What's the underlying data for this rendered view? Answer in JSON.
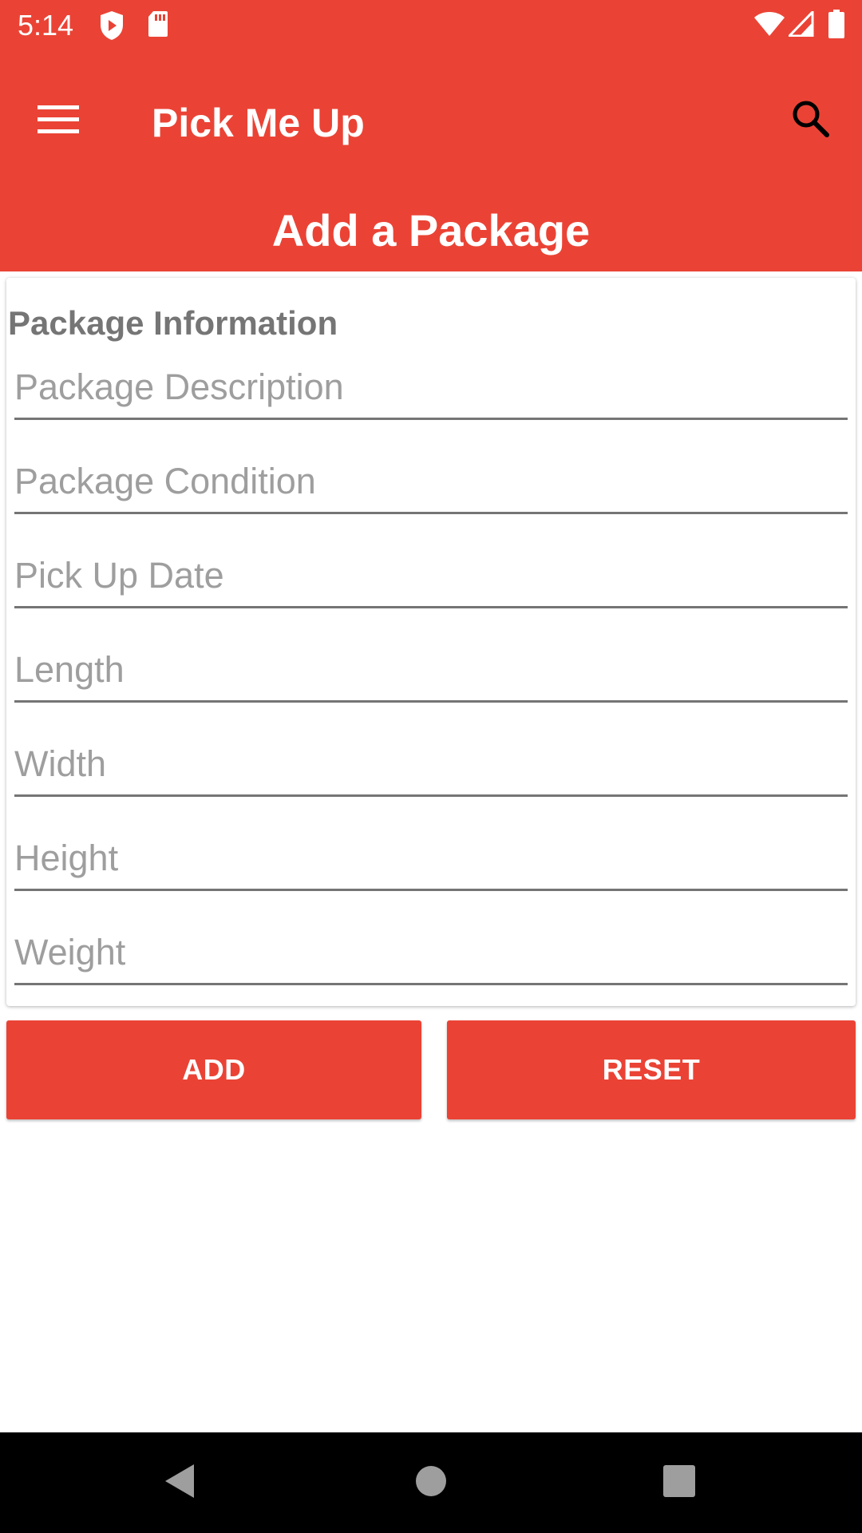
{
  "status_bar": {
    "time": "5:14",
    "icons": [
      "shield-play-icon",
      "sd-card-icon",
      "wifi-icon",
      "signal-icon",
      "battery-icon"
    ]
  },
  "toolbar": {
    "app_title": "Pick Me Up",
    "page_heading": "Add a Package",
    "menu_icon": "hamburger-menu-icon",
    "search_icon": "search-icon"
  },
  "form": {
    "section_title": "Package Information",
    "fields": [
      {
        "placeholder": "Package Description",
        "value": ""
      },
      {
        "placeholder": "Package Condition",
        "value": ""
      },
      {
        "placeholder": "Pick Up Date",
        "value": ""
      },
      {
        "placeholder": "Length",
        "value": ""
      },
      {
        "placeholder": "Width",
        "value": ""
      },
      {
        "placeholder": "Height",
        "value": ""
      },
      {
        "placeholder": "Weight",
        "value": ""
      }
    ]
  },
  "actions": {
    "add_label": "ADD",
    "reset_label": "RESET"
  },
  "nav_bar": {
    "icons": [
      "back-icon",
      "home-icon",
      "recents-icon"
    ]
  },
  "colors": {
    "primary": "#ea4335",
    "on_primary": "#ffffff",
    "section_title": "#757575",
    "placeholder": "#9e9e9e",
    "underline": "#757575"
  }
}
